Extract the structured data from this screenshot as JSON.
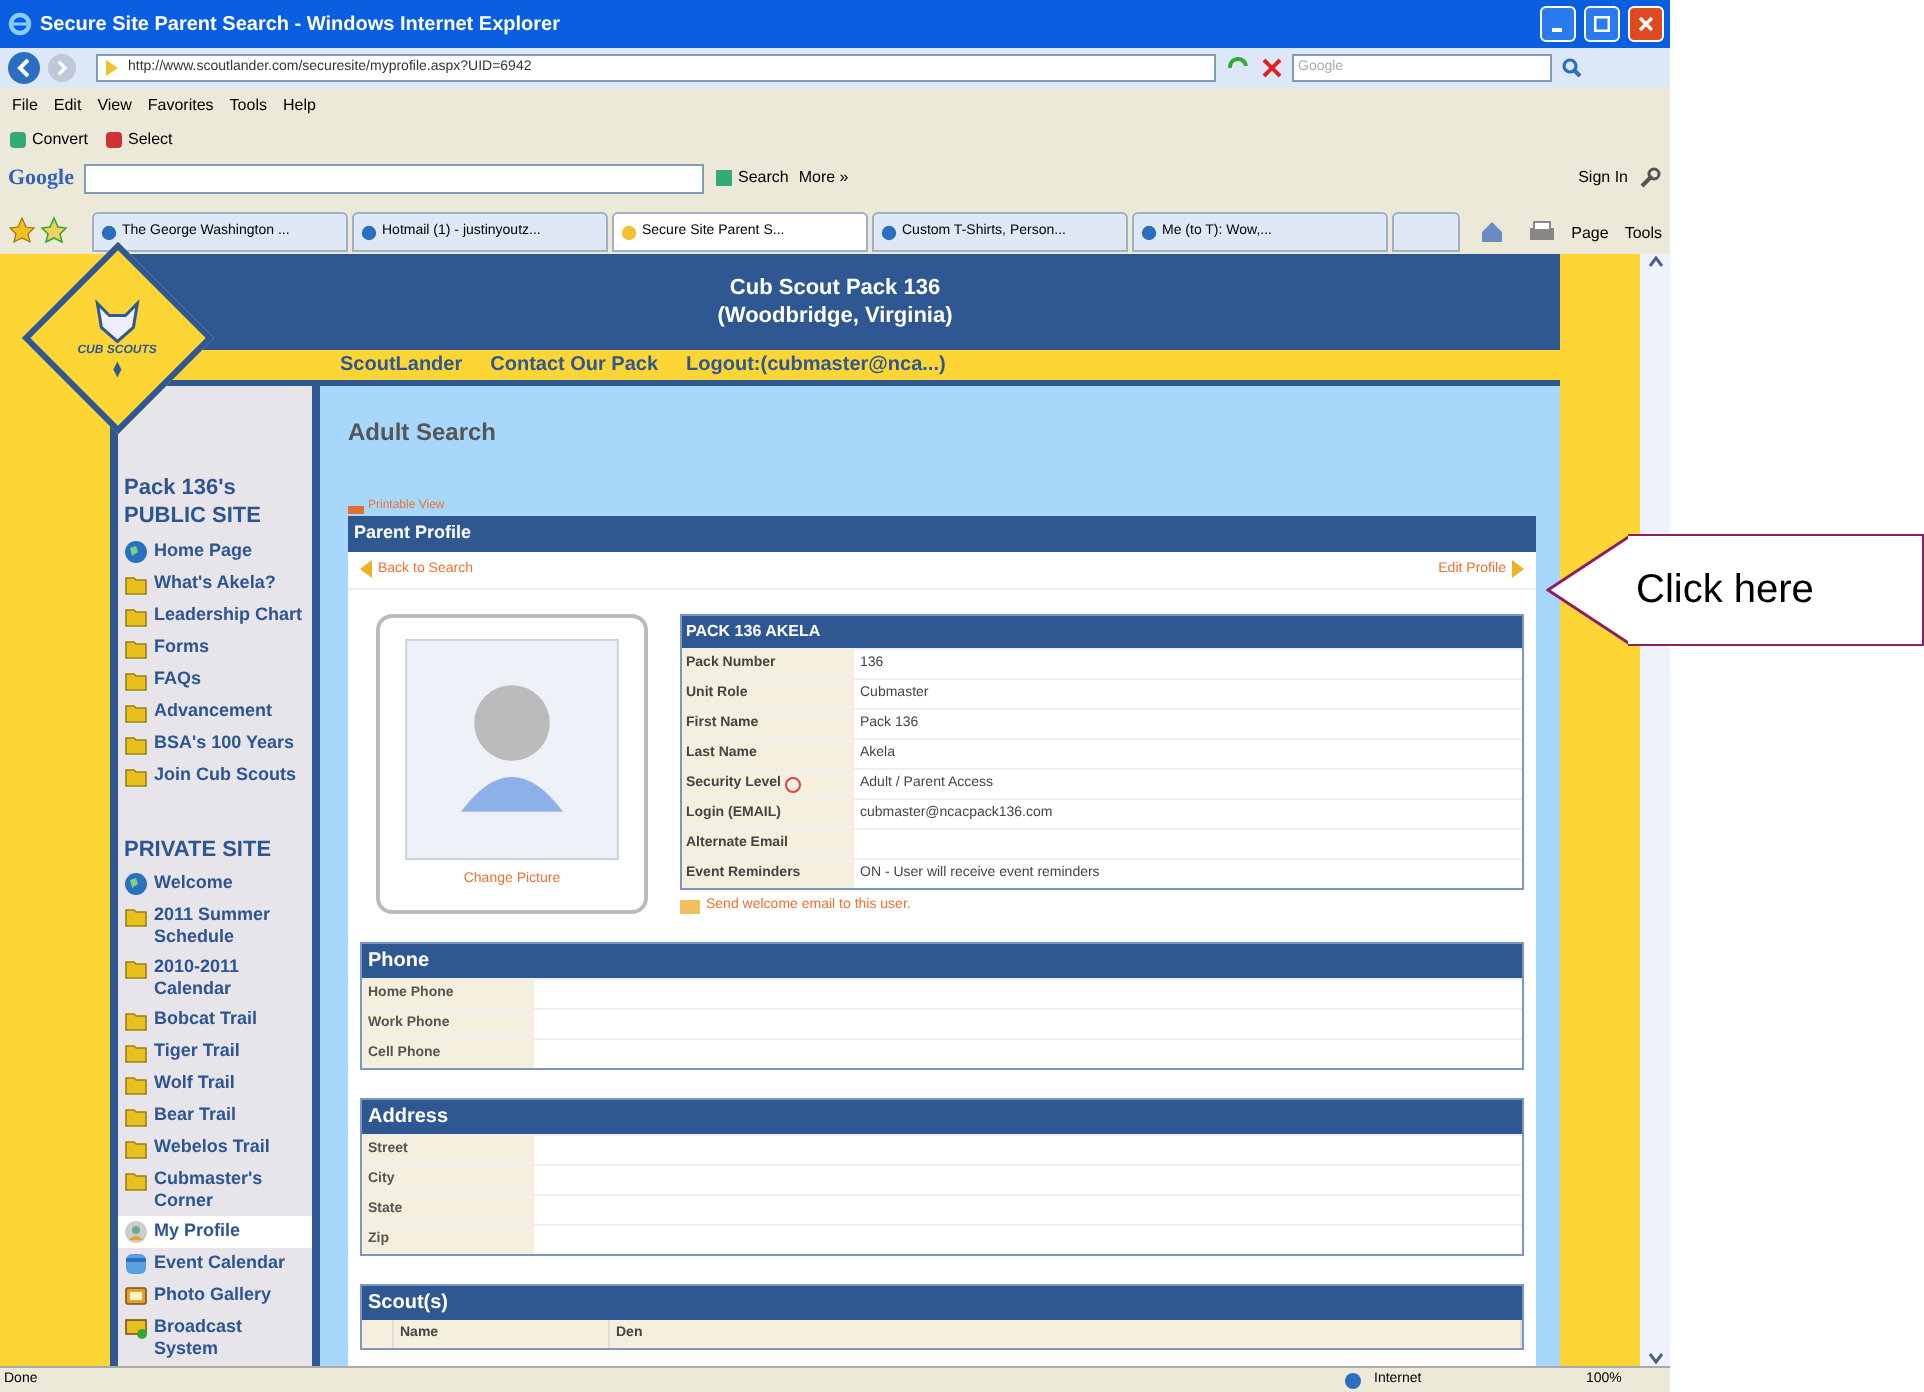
{
  "window": {
    "title": "Secure Site Parent Search - Windows Internet Explorer"
  },
  "address_bar": {
    "url": "http://www.scoutlander.com/securesite/myprofile.aspx?UID=6942",
    "search_placeholder": "Google"
  },
  "menu": [
    "File",
    "Edit",
    "View",
    "Favorites",
    "Tools",
    "Help"
  ],
  "toolbar": [
    "Convert",
    "Select"
  ],
  "google_bar": {
    "logo": "Google",
    "search": "Search",
    "more": "More »",
    "sign_in": "Sign In"
  },
  "tabs": [
    {
      "label": "The George Washington ...",
      "selected": false
    },
    {
      "label": "Hotmail (1) - justinyoutz...",
      "selected": false
    },
    {
      "label": "Secure Site Parent S...",
      "selected": true
    },
    {
      "label": "Custom T-Shirts, Person...",
      "selected": false
    },
    {
      "label": "Me (to T): Wow,...",
      "selected": false
    }
  ],
  "command_bar": [
    "Page",
    "Tools"
  ],
  "site": {
    "title": "Cub Scout Pack 136",
    "subtitle": "(Woodbridge, Virginia)",
    "logo_text": "CUB SCOUTS",
    "nav": [
      "ScoutLander",
      "Contact Our Pack",
      "Logout:(cubmaster@nca...)"
    ]
  },
  "sidebar": {
    "public_heading": "Pack 136's",
    "public_subheading": "PUBLIC SITE",
    "public_items": [
      {
        "label": "Home Page",
        "kind": "globe",
        "selected": false
      },
      {
        "label": "What's Akela?",
        "kind": "folder",
        "selected": false
      },
      {
        "label": "Leadership Chart",
        "kind": "folder",
        "selected": false
      },
      {
        "label": "Forms",
        "kind": "folder",
        "selected": false
      },
      {
        "label": "FAQs",
        "kind": "folder",
        "selected": false
      },
      {
        "label": "Advancement",
        "kind": "folder",
        "selected": false
      },
      {
        "label": "BSA's 100 Years",
        "kind": "folder",
        "selected": false
      },
      {
        "label": "Join Cub Scouts",
        "kind": "folder",
        "selected": false
      }
    ],
    "private_heading": "PRIVATE SITE",
    "private_items": [
      {
        "label": "Welcome",
        "kind": "globe",
        "selected": false
      },
      {
        "label": "2011 Summer Schedule",
        "kind": "folder",
        "selected": false
      },
      {
        "label": "2010-2011 Calendar",
        "kind": "folder",
        "selected": false
      },
      {
        "label": "Bobcat Trail",
        "kind": "folder",
        "selected": false
      },
      {
        "label": "Tiger Trail",
        "kind": "folder",
        "selected": false
      },
      {
        "label": "Wolf Trail",
        "kind": "folder",
        "selected": false
      },
      {
        "label": "Bear Trail",
        "kind": "folder",
        "selected": false
      },
      {
        "label": "Webelos Trail",
        "kind": "folder",
        "selected": false
      },
      {
        "label": "Cubmaster's Corner",
        "kind": "folder",
        "selected": false
      },
      {
        "label": "My Profile",
        "kind": "profile",
        "selected": true
      },
      {
        "label": "Event Calendar",
        "kind": "calendar",
        "selected": false
      },
      {
        "label": "Photo Gallery",
        "kind": "gallery",
        "selected": false
      },
      {
        "label": "Broadcast System",
        "kind": "broadcast",
        "selected": false
      }
    ]
  },
  "page": {
    "heading": "Adult Search",
    "printable": "Printable View",
    "panel_title": "Parent Profile",
    "back": "Back to Search",
    "edit": "Edit Profile",
    "change_picture": "Change Picture",
    "profile": {
      "title": "PACK 136 AKELA",
      "rows": [
        {
          "label": "Pack Number",
          "value": "136",
          "help_icon": false
        },
        {
          "label": "Unit Role",
          "value": "Cubmaster",
          "help_icon": false
        },
        {
          "label": "First Name",
          "value": "Pack 136",
          "help_icon": false
        },
        {
          "label": "Last Name",
          "value": "Akela",
          "help_icon": false
        },
        {
          "label": "Security Level",
          "value": "Adult / Parent Access",
          "help_icon": true
        },
        {
          "label": "Login (EMAIL)",
          "value": "cubmaster@ncacpack136.com",
          "help_icon": false
        },
        {
          "label": "Alternate Email",
          "help_icon": false
        },
        {
          "label": "Event Reminders",
          "value": "ON - User will receive event reminders",
          "help_icon": false
        }
      ]
    },
    "send_email": "Send welcome email to this user.",
    "phone": {
      "title": "Phone",
      "rows": [
        "Home Phone",
        "Work Phone",
        "Cell Phone"
      ]
    },
    "address": {
      "title": "Address",
      "rows": [
        "Street",
        "City",
        "State",
        "Zip"
      ]
    },
    "scouts": {
      "title": "Scout(s)",
      "columns": [
        "Name",
        "Den"
      ]
    }
  },
  "status_bar": {
    "text": "Done",
    "zone": "Internet",
    "zoom": "100%"
  },
  "callout": {
    "text": "Click here"
  }
}
